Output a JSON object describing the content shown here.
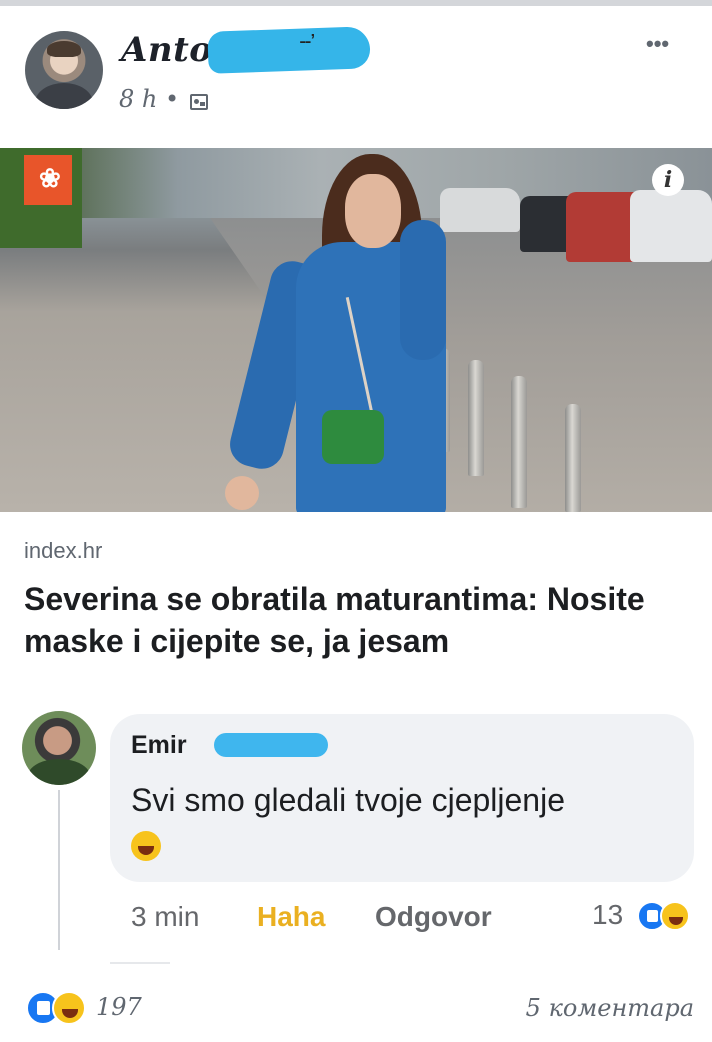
{
  "post": {
    "author_name": "Anto",
    "author_name_tail": "˗˗’",
    "time": "8 h •",
    "audience_icon": "friends-icon",
    "more_icon": "•••"
  },
  "photo": {
    "brand_badge": "❀",
    "info_icon": "i"
  },
  "link": {
    "domain": "index.hr",
    "title": "Severina se obratila maturantima: Nosite maske i cijepite se, ja jesam"
  },
  "comment": {
    "name": "Emir",
    "text": "Svi smo gledali tvoje cjepljenje",
    "emoji": "laughing-emoji",
    "time": "3 min",
    "haha_label": "Haha",
    "reply_label": "Odgovor",
    "reaction_count": "13"
  },
  "footer": {
    "reaction_count": "197",
    "comments_label": "5 коментара"
  },
  "colors": {
    "link_blue": "#1877f2",
    "haha_yellow": "#eab021",
    "redaction_blue": "#35b5e9"
  }
}
